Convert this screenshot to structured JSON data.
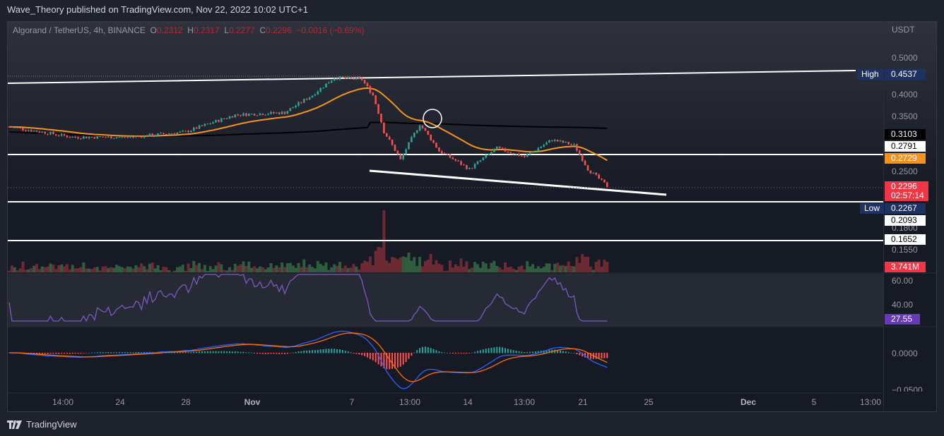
{
  "header": {
    "publisher": "Wave_Theory published on TradingView.com, Nov 22, 2022 10:02 UTC+1"
  },
  "legend": {
    "symbol": "Algorand / TetherUS, 4h, BINANCE",
    "o_label": "O",
    "o": "0.2312",
    "h_label": "H",
    "h": "0.2317",
    "l_label": "L",
    "l": "0.2277",
    "c_label": "C",
    "c": "0.2296",
    "change": "−0.0016 (−0.69%)"
  },
  "price_axis": {
    "currency": "USDT",
    "ticks": [
      "0.5000",
      "0.4000",
      "0.3500",
      "0.2500",
      "0.1800",
      "0.1550"
    ]
  },
  "tags": {
    "high_label": "High",
    "high": "0.4537",
    "sma": "0.3103",
    "line_2791": "0.2791",
    "ema": "0.2729",
    "last": "0.2296",
    "countdown": "02:57:14",
    "low_label": "Low",
    "low": "0.2267",
    "line_2093": "0.2093",
    "line_1652": "0.1652",
    "volume": "3.741M",
    "rsi": "27.55"
  },
  "rsi_axis": {
    "ticks": [
      "60.00",
      "40.00"
    ]
  },
  "macd_axis": {
    "ticks": [
      "0.0000",
      "−0.0500"
    ]
  },
  "time_axis": {
    "ticks": [
      "14:00",
      "24",
      "28",
      "Nov",
      "7",
      "13:00",
      "14",
      "13:00",
      "21",
      "25",
      "Dec",
      "5",
      "13:00"
    ]
  },
  "colors": {
    "up": "#26a69a",
    "down": "#ef5350",
    "ema": "#f7931a",
    "rsi": "#7e57c2",
    "last": "#f23645",
    "axis_blue": "#1e3163"
  },
  "footer": {
    "brand": "TradingView"
  },
  "price_keypoints": [
    [
      0,
      0.33
    ],
    [
      23,
      0.31
    ],
    [
      44,
      0.31
    ],
    [
      64,
      0.32
    ],
    [
      82,
      0.355
    ],
    [
      100,
      0.36
    ],
    [
      110,
      0.4
    ],
    [
      118,
      0.445
    ],
    [
      128,
      0.44
    ],
    [
      132,
      0.4
    ],
    [
      136,
      0.32
    ],
    [
      142,
      0.27
    ],
    [
      149,
      0.335
    ],
    [
      156,
      0.285
    ],
    [
      167,
      0.255
    ],
    [
      177,
      0.29
    ],
    [
      187,
      0.275
    ],
    [
      197,
      0.305
    ],
    [
      205,
      0.295
    ],
    [
      210,
      0.255
    ],
    [
      217,
      0.23
    ]
  ]
}
